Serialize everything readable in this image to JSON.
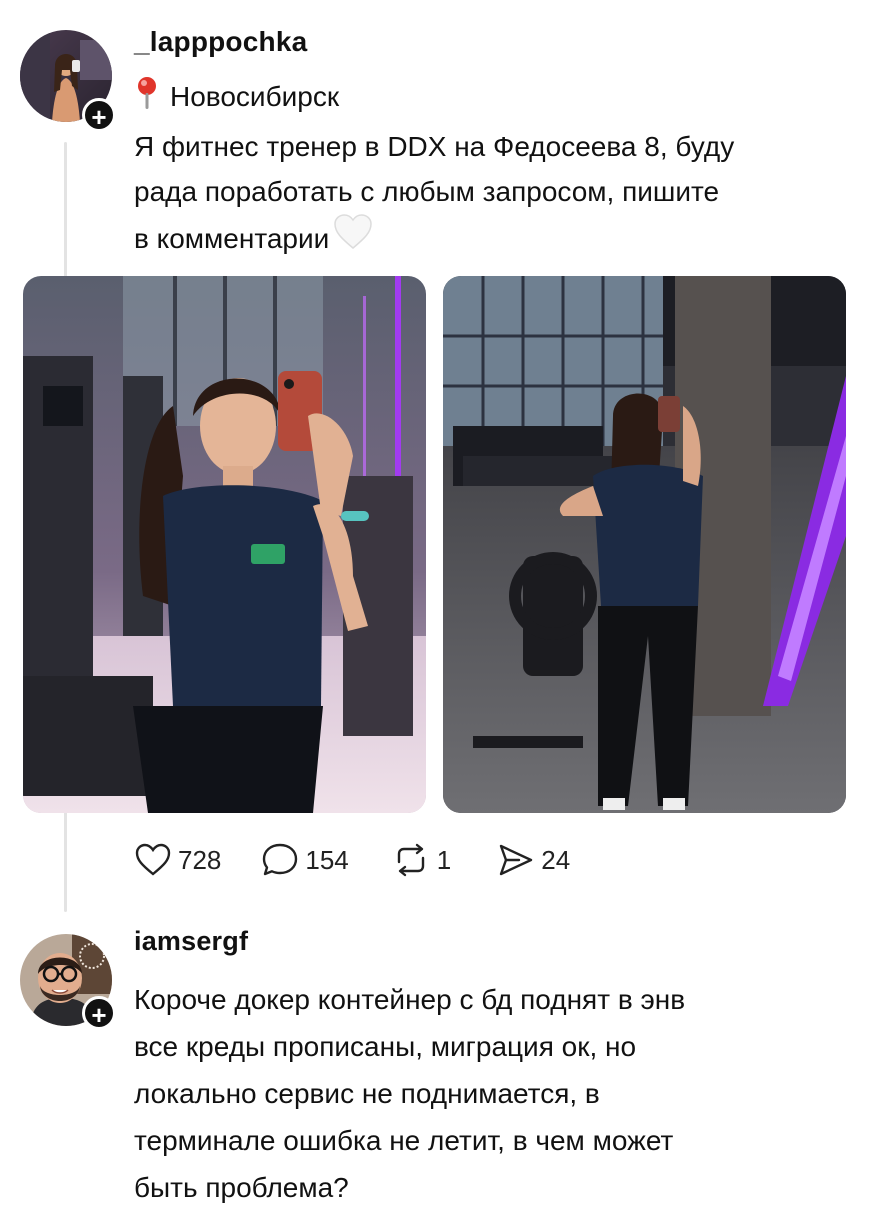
{
  "post": {
    "username": "_lapppochka",
    "location_pin": "pin-icon",
    "location": "Новосибирск",
    "text_lines": [
      "Я фитнес тренер в DDX на Федосеева 8, буду",
      "рада поработать с любым запросом, пишите",
      "в комментарии"
    ],
    "emoji": "white-heart-icon",
    "stats": {
      "likes": "728",
      "comments": "154",
      "reposts": "1",
      "shares": "24"
    }
  },
  "comment": {
    "username": "iamsergf",
    "text_lines": [
      "Короче докер контейнер с бд поднят в энв",
      "все креды прописаны, миграция ок, но",
      "локально сервис не поднимается, в",
      "терминале ошибка не летит, в чем может",
      "быть проблема?"
    ]
  },
  "colors": {
    "gym_purple": "#a23bf0",
    "shirt_navy": "#1c2a44",
    "text": "#111111",
    "divider": "#e3e3e3"
  }
}
